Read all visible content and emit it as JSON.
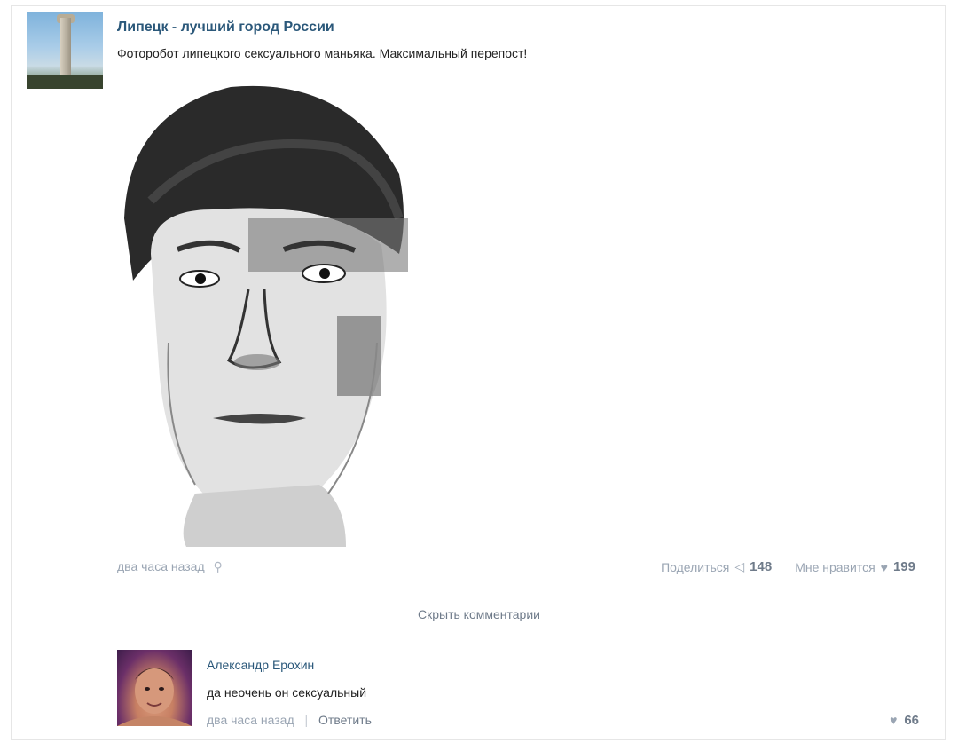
{
  "post": {
    "community_name": "Липецк - лучший город России",
    "text": "Фоторобот липецкого сексуального маньяка. Максимальный перепост!",
    "time": "два часа назад",
    "share_label": "Поделиться",
    "share_count": "148",
    "like_label": "Мне нравится",
    "like_count": "199",
    "hide_comments_label": "Скрыть комментарии"
  },
  "comment": {
    "author": "Александр Ерохин",
    "text": "да неочень он сексуальный",
    "time": "два часа назад",
    "separator": "|",
    "reply_label": "Ответить",
    "like_count": "66"
  },
  "icons": {
    "pin": "pin-icon",
    "share": "megaphone-icon",
    "like": "heart-icon"
  },
  "colors": {
    "link": "#2b587a",
    "muted": "#9aa5b3"
  }
}
